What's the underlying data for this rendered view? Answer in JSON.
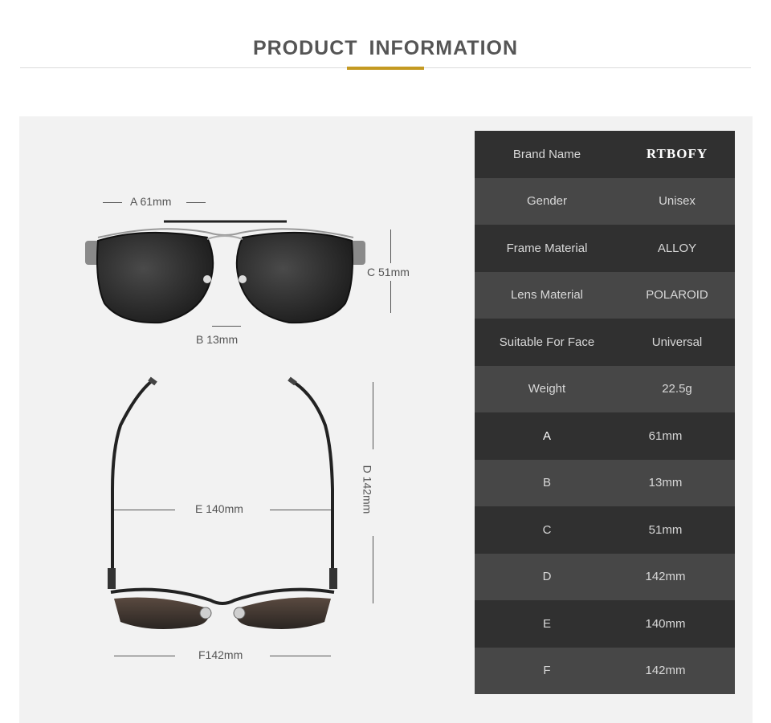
{
  "header": {
    "title": "PRODUCT INFORMATION",
    "accent_color": "#c49a22"
  },
  "dimensions": {
    "a": "A 61mm",
    "b": "B 13mm",
    "c": "C 51mm",
    "d": "D 142mm",
    "e": "E 140mm",
    "f": "F142mm"
  },
  "specs": {
    "brand": {
      "label": "Brand Name",
      "value": "RTBOFY"
    },
    "gender": {
      "label": "Gender",
      "value": "Unisex"
    },
    "frame": {
      "label": "Frame Material",
      "value": "ALLOY"
    },
    "lens": {
      "label": "Lens Material",
      "value": "POLAROID"
    },
    "face": {
      "label": "Suitable For Face",
      "value": "Universal"
    },
    "weight": {
      "label": "Weight",
      "value": "22.5g"
    },
    "A": {
      "label": "A",
      "value": "61mm"
    },
    "B": {
      "label": "B",
      "value": "13mm"
    },
    "C": {
      "label": "C",
      "value": "51mm"
    },
    "D": {
      "label": "D",
      "value": "142mm"
    },
    "E": {
      "label": "E",
      "value": "140mm"
    },
    "F": {
      "label": "F",
      "value": "142mm"
    }
  }
}
